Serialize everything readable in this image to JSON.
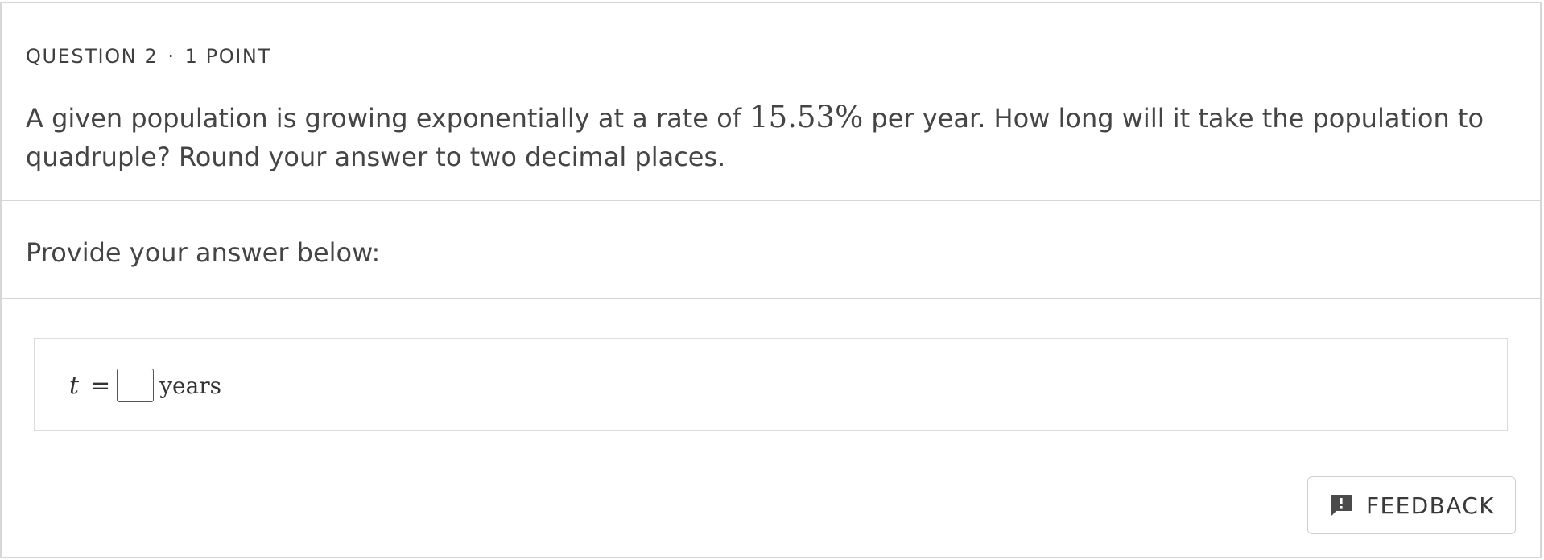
{
  "question": {
    "header_number": "QUESTION 2",
    "header_separator": "·",
    "header_points": "1 POINT",
    "prompt_before": "A given population is growing exponentially at a rate of ",
    "prompt_math": "15.53%",
    "prompt_after": " per year. How long will it take the population to quadruple? Round your answer to two decimal places."
  },
  "answer_section": {
    "label": "Provide your answer below:"
  },
  "answer": {
    "variable": "t",
    "equals": "=",
    "input_value": "",
    "unit": "years"
  },
  "feedback": {
    "label": "FEEDBACK",
    "icon": "feedback-icon"
  }
}
